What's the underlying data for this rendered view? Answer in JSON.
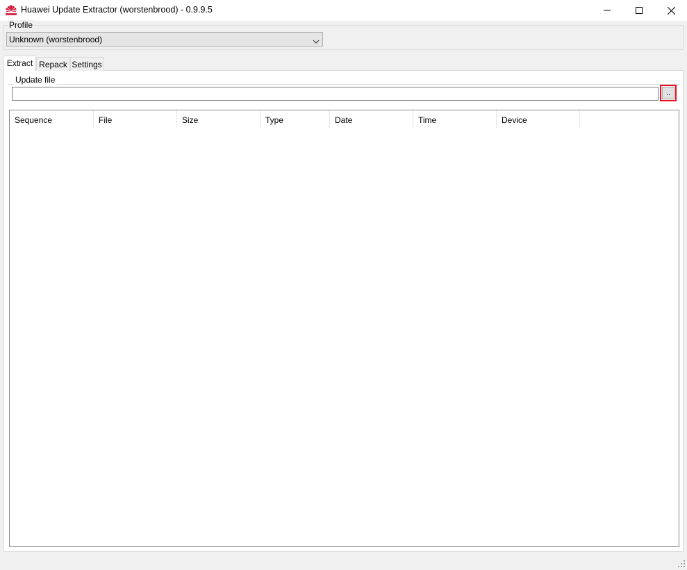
{
  "window": {
    "title": "Huawei Update Extractor (worstenbrood) - 0.9.9.5",
    "app_icon": "huawei-logo",
    "controls": {
      "minimize": "minimize-icon",
      "maximize": "maximize-icon",
      "close": "close-icon"
    }
  },
  "profile": {
    "legend": "Profile",
    "selected": "Unknown (worstenbrood)"
  },
  "tabs": [
    {
      "label": "Extract",
      "active": true
    },
    {
      "label": "Repack",
      "active": false
    },
    {
      "label": "Settings",
      "active": false
    }
  ],
  "extract": {
    "update_file_legend": "Update file",
    "update_file_value": "",
    "browse_label": "..",
    "highlight_color": "#e81123"
  },
  "table": {
    "columns": [
      "Sequence",
      "File",
      "Size",
      "Type",
      "Date",
      "Time",
      "Device"
    ],
    "rows": []
  },
  "colors": {
    "window_bg": "#f0f0f0",
    "brand_red": "#cf0a2c"
  }
}
